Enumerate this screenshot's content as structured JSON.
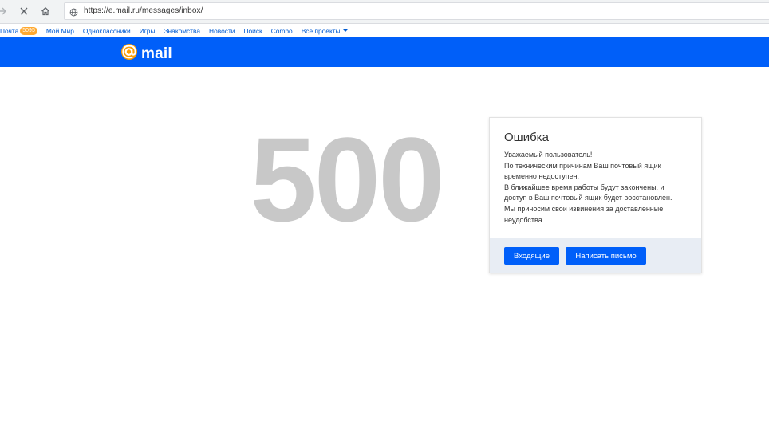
{
  "browser": {
    "url": "https://e.mail.ru/messages/inbox/"
  },
  "projects_bar": {
    "items": [
      {
        "label": "Почта",
        "badge": "5095"
      },
      {
        "label": "Мой Мир"
      },
      {
        "label": "Одноклассники"
      },
      {
        "label": "Игры"
      },
      {
        "label": "Знакомства"
      },
      {
        "label": "Новости"
      },
      {
        "label": "Поиск"
      },
      {
        "label": "Combo"
      },
      {
        "label": "Все проекты"
      }
    ]
  },
  "header": {
    "logo_text": "mail",
    "brand_color": "#005ff9"
  },
  "error": {
    "code": "500",
    "title": "Ошибка",
    "message_lines": [
      "Уважаемый пользователь!",
      "По техническим причинам Ваш почтовый ящик",
      "временно недоступен.",
      "В ближайшее время работы будут закончены, и",
      "доступ в Ваш почтовый ящик будет восстановлен.",
      "Мы приносим свои извинения за доставленные",
      "неудобства."
    ],
    "buttons": {
      "inbox": "Входящие",
      "compose": "Написать письмо"
    }
  },
  "icons": {
    "forward": "forward-arrow-icon",
    "stop": "close-icon",
    "home": "home-icon",
    "site": "globe-icon",
    "dropdown": "caret-down-icon",
    "logo": "at-sign-icon"
  }
}
